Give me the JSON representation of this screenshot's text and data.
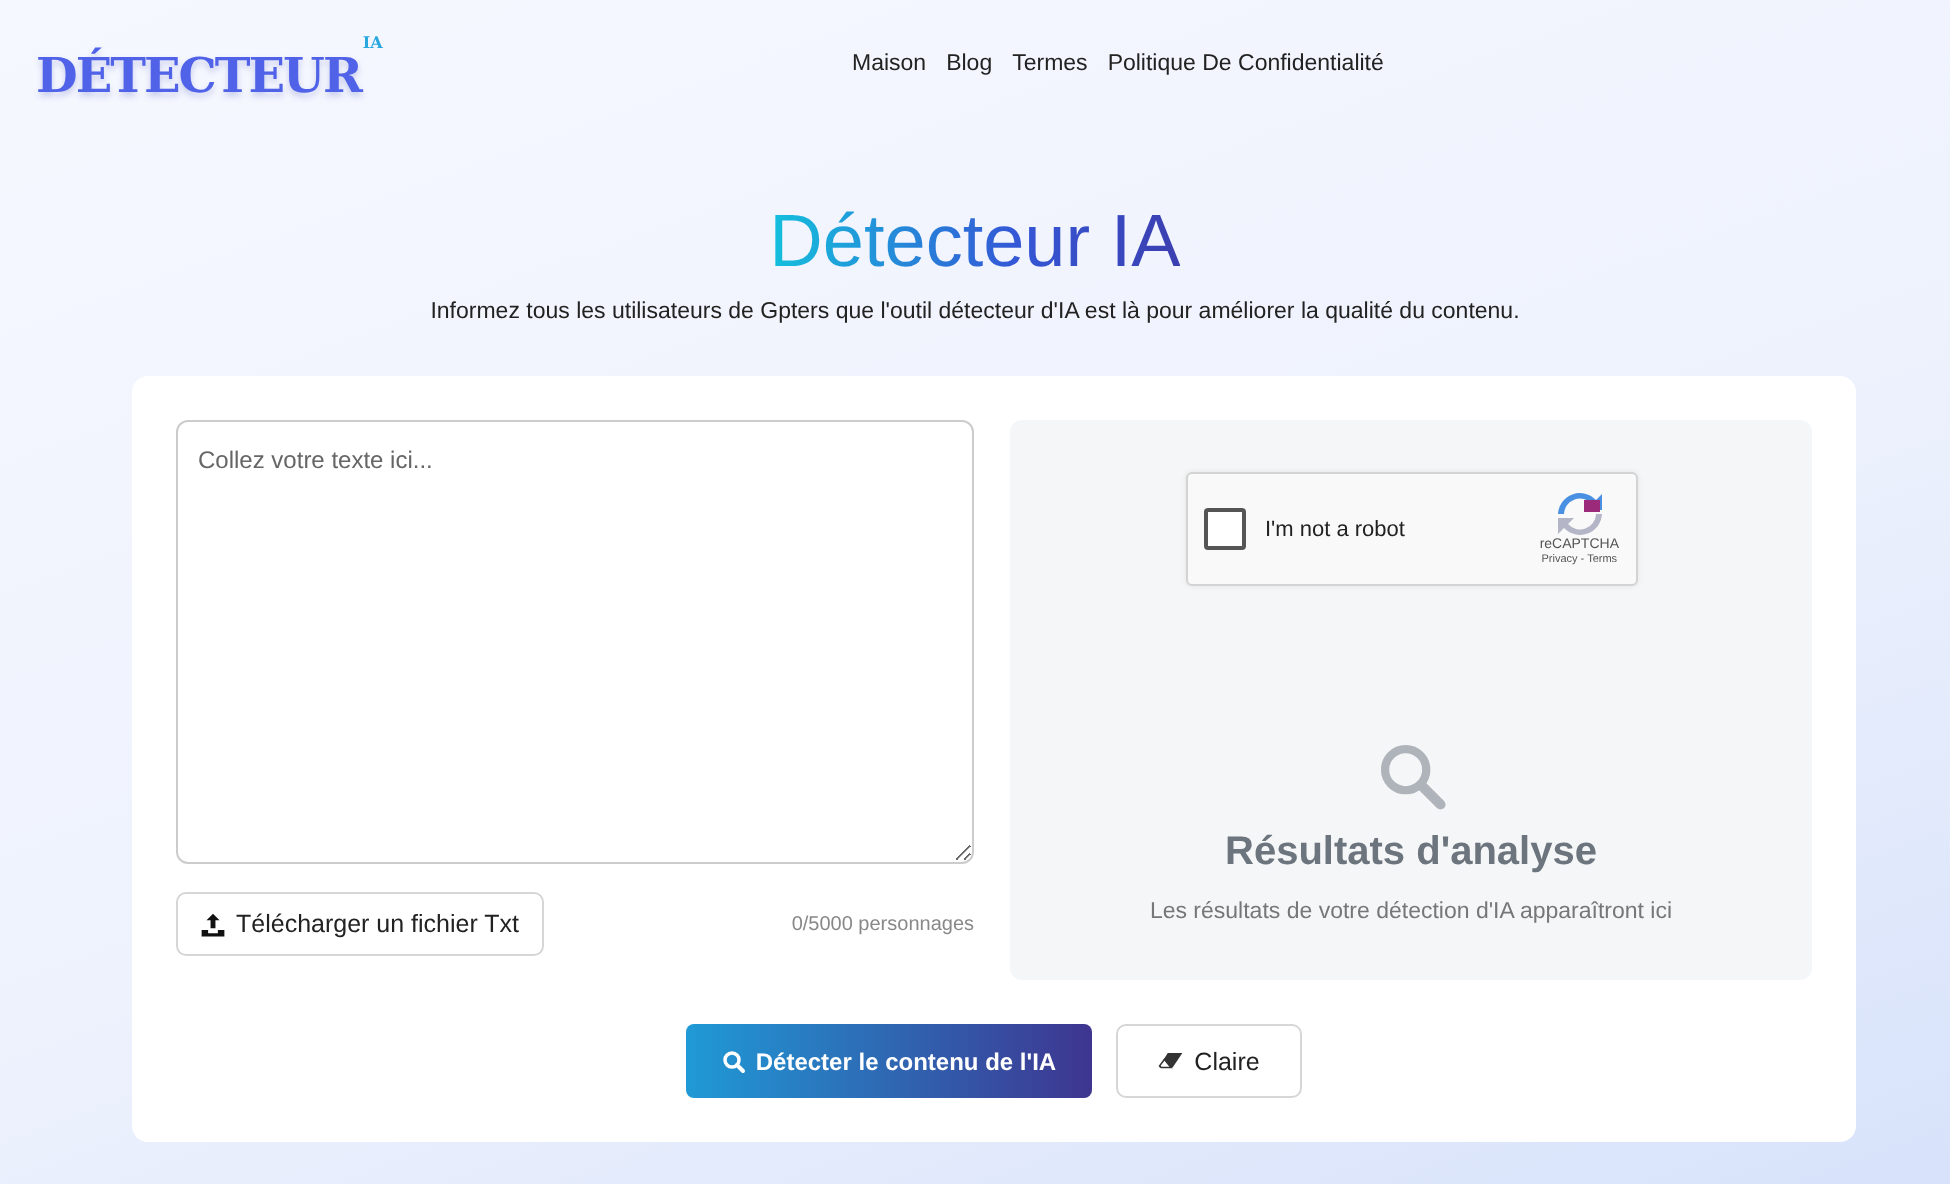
{
  "header": {
    "logo": {
      "text": "DÉTECTEUR",
      "badge": "IA"
    },
    "nav": [
      "Maison",
      "Blog",
      "Termes",
      "Politique De Confidentialité"
    ]
  },
  "hero": {
    "title": "Détecteur IA",
    "subtitle": "Informez tous les utilisateurs de Gpters que l'outil détecteur d'IA est là pour améliorer la qualité du contenu."
  },
  "input": {
    "placeholder": "Collez votre texte ici...",
    "upload_button": "Télécharger un fichier Txt",
    "counter": "0/5000 personnages"
  },
  "captcha": {
    "checked": false,
    "label": "I'm not a robot",
    "brand": "reCAPTCHA",
    "links": "Privacy - Terms"
  },
  "results": {
    "title": "Résultats d'analyse",
    "message": "Les résultats de votre détection d'IA apparaîtront ici"
  },
  "actions": {
    "detect": "Détecter le contenu de l'IA",
    "clear": "Claire"
  }
}
